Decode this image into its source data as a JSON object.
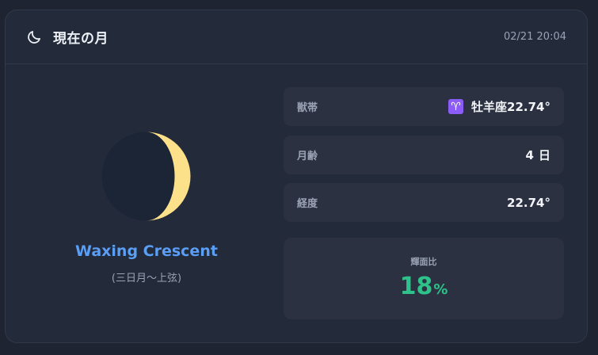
{
  "header": {
    "title": "現在の月",
    "datetime": "02/21 20:04",
    "icon": "moon-icon"
  },
  "moon": {
    "phase_name": "Waxing Crescent",
    "phase_subtitle": "(三日月〜上弦)",
    "illumination_fraction": 0.18,
    "colors": {
      "lit": "#fde18a",
      "dark": "#1c2535"
    }
  },
  "info": {
    "zodiac": {
      "label": "獣帯",
      "symbol": "♈",
      "sign": "牡羊座",
      "degrees": "22.74°"
    },
    "moon_age": {
      "label": "月齢",
      "value": "4",
      "unit": "日"
    },
    "longitude": {
      "label": "経度",
      "value": "22.74°"
    }
  },
  "illumination": {
    "label": "輝面比",
    "value": "18",
    "unit": "%"
  },
  "colors": {
    "accent_blue": "#5a9ef5",
    "accent_green": "#2ec28a",
    "zodiac_badge": "#8b5cf6",
    "card_bg": "#232a39",
    "row_bg": "#2b3140"
  }
}
